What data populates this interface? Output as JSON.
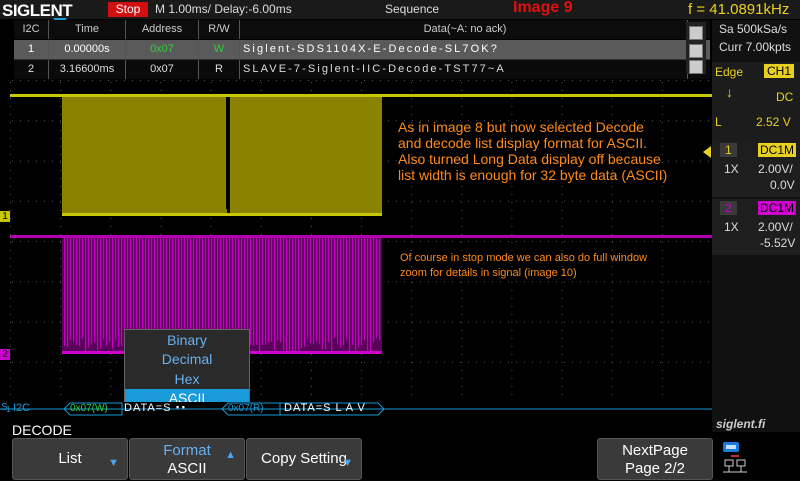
{
  "topbar": {
    "logo": "SIGLENT",
    "run_state": "Stop",
    "timebase": "M 1.00ms/ Delay:-6.00ms",
    "trigger_mode": "Sequence",
    "image_tag": "Image 9",
    "frequency": "f = 41.0891kHz"
  },
  "decode_table": {
    "headers": [
      "I2C",
      "Time",
      "Address",
      "R/W",
      "Data(~A: no ack)"
    ],
    "rows": [
      {
        "index": "1",
        "time": "0.00000s",
        "address": "0x07",
        "rw": "W",
        "data": "Siglent-SDS1104X-E-Decode-SL7OK?"
      },
      {
        "index": "2",
        "time": "3.16600ms",
        "address": "0x07",
        "rw": "R",
        "data": "SLAVE-7-Siglent-IIC-Decode-TST77~A"
      }
    ]
  },
  "right_panel": {
    "sample_rate": "Sa 500kSa/s",
    "memory": "Curr 7.00kpts",
    "trigger_type": "Edge",
    "trigger_source": "CH1",
    "coupling": "DC",
    "level_label": "L",
    "level_value": "2.52 V",
    "ch1": {
      "num": "1",
      "coupling": "DC1M",
      "probe": "1X",
      "scale": "2.00V/",
      "offset": "0.0V"
    },
    "ch2": {
      "num": "2",
      "coupling": "DC1M",
      "probe": "1X",
      "scale": "2.00V/",
      "offset": "-5.52V"
    }
  },
  "waveform": {
    "ch1_marker": "1",
    "ch2_marker": "2",
    "trigger_marker": "T"
  },
  "decode_bus": {
    "label_s": "S",
    "label_num": "1",
    "label": "I2C",
    "seg1_addr": "0x07(W)",
    "seg1_data": "DATA=S",
    "seg1_more": "▪ ▪",
    "seg2_addr": "0x07(R)",
    "seg2_data": "DATA=S L A V"
  },
  "annotations": {
    "note1": "As in image 8 but now selected Decode and decode list display format for ASCII. Also turned Long Data display off because list width is enough for 32 byte data (ASCII)",
    "note2": "Of course in stop mode we can also do full window zoom for details in signal (image 10)"
  },
  "format_menu": {
    "options": [
      "Binary",
      "Decimal",
      "Hex",
      "ASCII"
    ],
    "selected": "ASCII"
  },
  "menu_title": "DECODE",
  "watermark": "siglent.fi",
  "softkeys": {
    "list": "List",
    "format_line1": "Format",
    "format_line2": "ASCII",
    "copy": "Copy Setting",
    "next_line1": "NextPage",
    "next_line2": "Page 2/2"
  },
  "colors": {
    "ch1": "#c8c800",
    "ch2": "#d000d0",
    "accent": "#1a9ad8",
    "note": "#ff8a1a"
  }
}
